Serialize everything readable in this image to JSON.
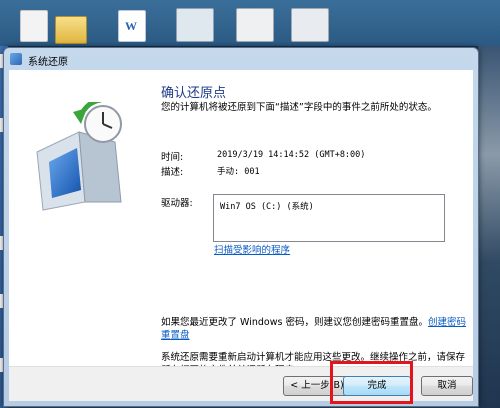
{
  "window": {
    "title": "系统还原"
  },
  "page": {
    "heading": "确认还原点",
    "description": "您的计算机将被还原到下面“描述”字段中的事件之前所处的状态。"
  },
  "details": {
    "time_label": "时间:",
    "time_value": "2019/3/19 14:14:52 (GMT+8:00)",
    "desc_label": "描述:",
    "desc_value": "手动: 001"
  },
  "drives": {
    "label": "驱动器:",
    "items": [
      "Win7 OS (C:) (系统)"
    ],
    "scan_link": "扫描受影响的程序"
  },
  "notes": {
    "password_text": "如果您最近更改了 Windows 密码，则建议您创建密码重置盘。",
    "password_link": "创建密码重置盘",
    "restart_text": "系统还原需要重新启动计算机才能应用这些更改。继续操作之前，请保存所有打开的文件并关闭所有程序。"
  },
  "buttons": {
    "back": "< 上一步(B)",
    "finish": "完成",
    "cancel": "取消"
  },
  "colors": {
    "highlight": "#e2141c",
    "heading": "#1e3a8a",
    "link": "#0a5bc4"
  }
}
